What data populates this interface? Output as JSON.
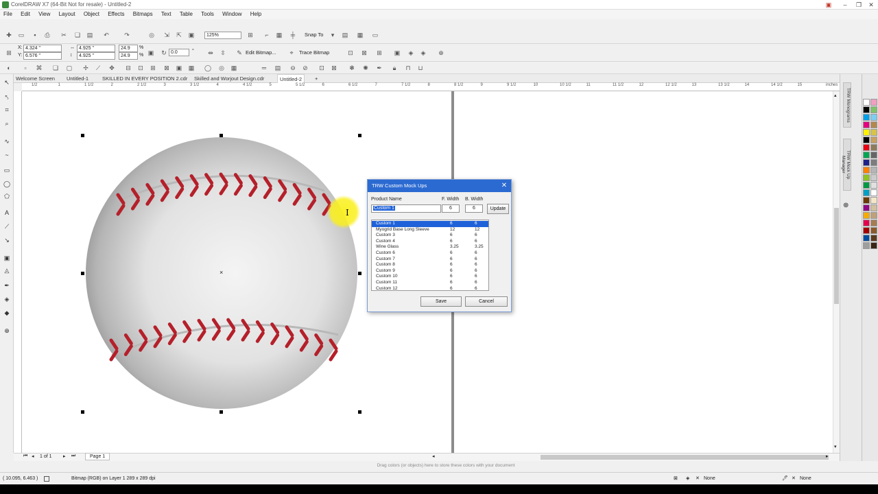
{
  "window": {
    "title": "CorelDRAW X7 (64-Bit Not for resale) - Untitled-2"
  },
  "menu": [
    {
      "label": "File"
    },
    {
      "label": "Edit"
    },
    {
      "label": "View"
    },
    {
      "label": "Layout"
    },
    {
      "label": "Object"
    },
    {
      "label": "Effects"
    },
    {
      "label": "Bitmaps"
    },
    {
      "label": "Text"
    },
    {
      "label": "Table"
    },
    {
      "label": "Tools"
    },
    {
      "label": "Window"
    },
    {
      "label": "Help"
    }
  ],
  "standard_toolbar": {
    "zoom": "125%",
    "snap_to": "Snap To"
  },
  "property_bar": {
    "x": "4.324 \"",
    "y": "6.576 \"",
    "width": "4.925 \"",
    "height": "4.925 \"",
    "scale_x": "24.9",
    "scale_y": "24.9",
    "pct": "%",
    "angle": "0.0",
    "edit_bitmap": "Edit Bitmap...",
    "trace_bitmap": "Trace Bitmap"
  },
  "tabs": [
    {
      "label": "Welcome Screen"
    },
    {
      "label": "Untitled-1"
    },
    {
      "label": "SKILLED IN EVERY POSITION 2.cdr"
    },
    {
      "label": "Skilled and Worjout Design.cdr"
    },
    {
      "label": "Untitled-2"
    }
  ],
  "ruler": {
    "ticks": [
      "1/2",
      "1",
      "1 1/2",
      "2",
      "2 1/2",
      "3",
      "3 1/2",
      "4",
      "4 1/2",
      "5",
      "5 1/2",
      "6",
      "6 1/2",
      "7",
      "7 1/2",
      "8",
      "8 1/2",
      "9",
      "9 1/2",
      "10",
      "10 1/2",
      "11",
      "11 1/2",
      "12",
      "12 1/2",
      "13",
      "13 1/2",
      "14",
      "14 1/2",
      "15"
    ],
    "unit": "inches"
  },
  "dialog": {
    "title": "TRW Custom Mock Ups",
    "product_name_label": "Product Name",
    "f_width_label": "F. Width",
    "b_width_label": "B. Width",
    "product_name_value": "Custom 1",
    "f_width_value": "6",
    "b_width_value": "6",
    "update_label": "Update",
    "save_label": "Save",
    "cancel_label": "Cancel",
    "rows": [
      {
        "name": "Custom 1",
        "f": "6",
        "b": "6"
      },
      {
        "name": "Myogrid Base Long Sleeve",
        "f": "12",
        "b": "12"
      },
      {
        "name": "Custom 3",
        "f": "6",
        "b": "6"
      },
      {
        "name": "Custom 4",
        "f": "6",
        "b": "6"
      },
      {
        "name": "Wine Glass",
        "f": "3.25",
        "b": "3.25"
      },
      {
        "name": "Custom 6",
        "f": "6",
        "b": "6"
      },
      {
        "name": "Custom 7",
        "f": "6",
        "b": "6"
      },
      {
        "name": "Custom 8",
        "f": "6",
        "b": "6"
      },
      {
        "name": "Custom 9",
        "f": "6",
        "b": "6"
      },
      {
        "name": "Custom 10",
        "f": "6",
        "b": "6"
      },
      {
        "name": "Custom 11",
        "f": "6",
        "b": "6"
      },
      {
        "name": "Custom 12",
        "f": "6",
        "b": "6"
      }
    ],
    "selected_index": 0
  },
  "dockers": {
    "tab1": "TRW Monograms",
    "tab2": "TRW Mock Up Manager"
  },
  "page_nav": {
    "page_of": "1 of 1",
    "page_tab": "Page 1"
  },
  "hint": "Drag colors (or objects) here to store these colors with your document",
  "status": {
    "coords": "( 10.095, 6.463 )",
    "object_info": "Bitmap (RGB) on Layer 1 289 x 289 dpi",
    "fill_label": "None",
    "outline_label": "None"
  },
  "palette": [
    "#ffffff",
    "#000000",
    "#00a0e9",
    "#e4007f",
    "#fff100",
    "#000000",
    "#e60012",
    "#00a651",
    "#1d2088",
    "#ff7f00",
    "#8fc31f",
    "#009944",
    "#00a0c6",
    "#6a3906",
    "#920783",
    "#f6ab00",
    "#e5004f",
    "#a40000",
    "#004da0",
    "#9e9e9e",
    "#f19ec2",
    "#80c269",
    "#7ecef4",
    "#b28850",
    "#d7c447",
    "#c9a063",
    "#8e7b5c",
    "#666666",
    "#7d7d7d",
    "#b5b5b5",
    "#cccccc",
    "#e0e0e0",
    "#ffffff",
    "#f5e6c8",
    "#d3c0a0",
    "#bfa07a",
    "#a67c52",
    "#8b5a2b",
    "#5c3a1e",
    "#3a2514"
  ]
}
